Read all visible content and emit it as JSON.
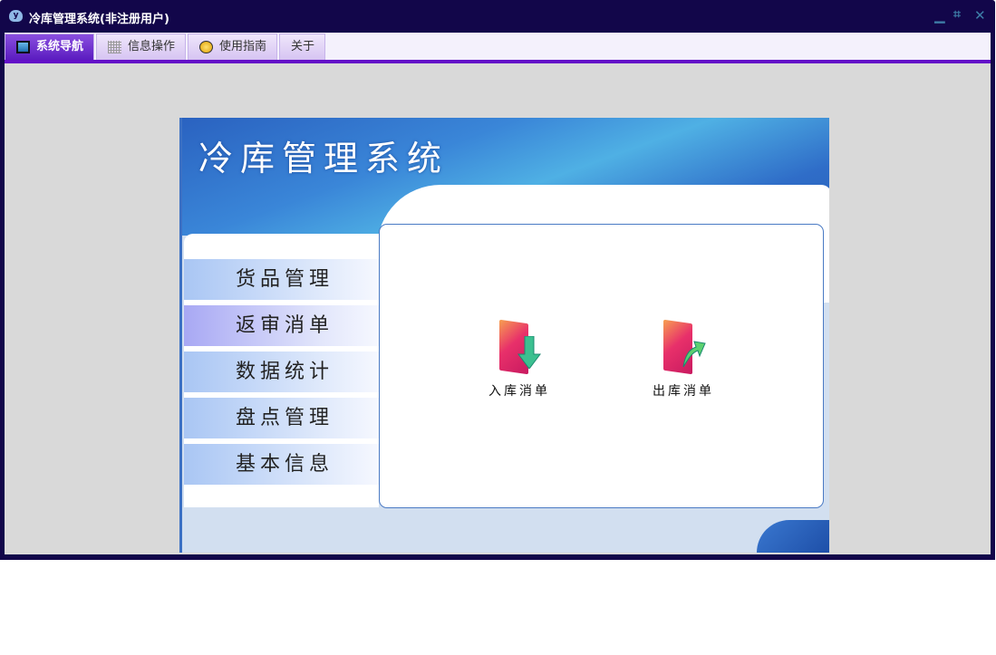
{
  "window": {
    "title": "冷库管理系统(非注册用户)",
    "icon_text": "y"
  },
  "window_controls": {
    "minimize": "minimize-icon",
    "restore": "restore-icon",
    "close": "close-icon"
  },
  "tabs": [
    {
      "label": "系统导航",
      "icon": "monitor-icon",
      "active": true
    },
    {
      "label": "信息操作",
      "icon": "grid-icon",
      "active": false
    },
    {
      "label": "使用指南",
      "icon": "help-icon",
      "active": false
    },
    {
      "label": "关于",
      "active": false
    }
  ],
  "banner": {
    "title": "冷库管理系统"
  },
  "menu": [
    {
      "label": "货品管理"
    },
    {
      "label": "返审消单",
      "selected": true
    },
    {
      "label": "数据统计"
    },
    {
      "label": "盘点管理"
    },
    {
      "label": "基本信息"
    }
  ],
  "actions": [
    {
      "label": "入库消单",
      "icon": "folder-in-icon"
    },
    {
      "label": "出库消单",
      "icon": "folder-out-icon"
    }
  ],
  "colors": {
    "frame": "#12064a",
    "accent": "#6310c8",
    "banner": "#3a86d8"
  }
}
